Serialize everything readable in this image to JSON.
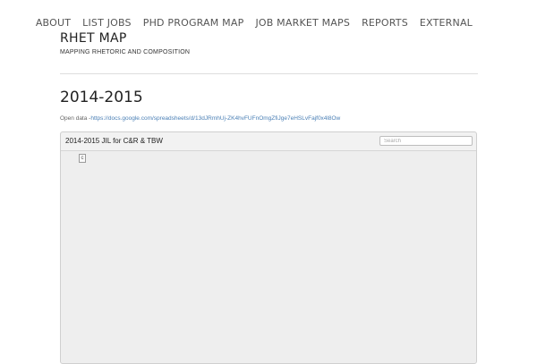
{
  "nav": {
    "items": [
      "ABOUT",
      "LIST JOBS",
      "PHD PROGRAM MAP",
      "JOB MARKET MAPS",
      "REPORTS",
      "EXTERNAL"
    ]
  },
  "site": {
    "title": "RHET MAP",
    "tagline": "MAPPING RHETORIC AND COMPOSITION"
  },
  "page": {
    "title": "2014-2015",
    "open_data_label": "Open data -",
    "open_data_link": "https://docs.google.com/spreadsheets/d/13dJRmhUj-ZK4hvFUFnOmgZfiJge7eHSLvFajf0x4l8Ow"
  },
  "embed": {
    "title": "2014-2015 JIL for C&R & TBW",
    "search_placeholder": "Search",
    "icon_glyph": "c"
  }
}
